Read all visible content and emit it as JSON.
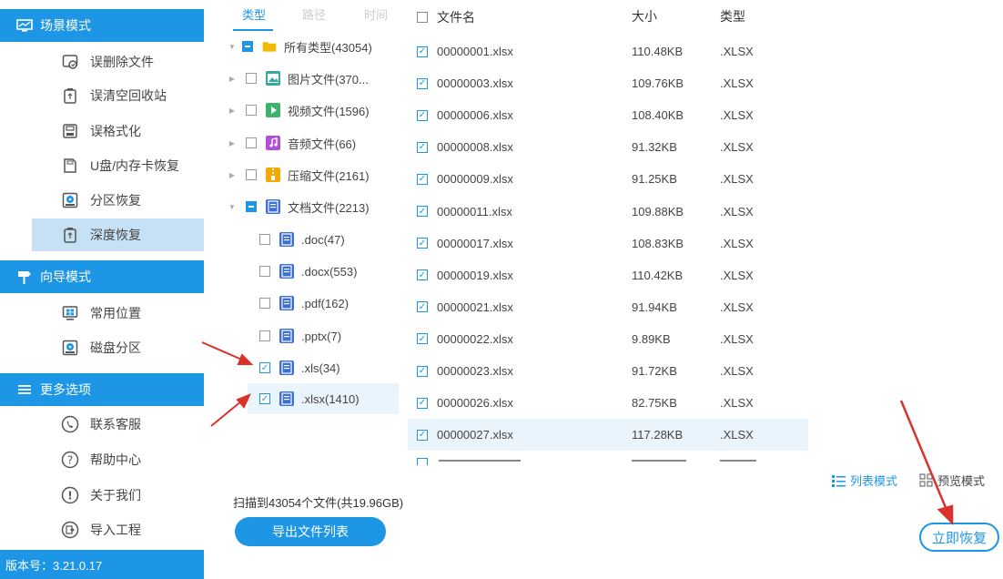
{
  "sidebar": {
    "scene_mode": "场景模式",
    "scene_items": [
      {
        "label": "误删除文件"
      },
      {
        "label": "误清空回收站"
      },
      {
        "label": "误格式化"
      },
      {
        "label": "U盘/内存卡恢复"
      },
      {
        "label": "分区恢复"
      },
      {
        "label": "深度恢复"
      }
    ],
    "guide_mode": "向导模式",
    "guide_items": [
      {
        "label": "常用位置"
      },
      {
        "label": "磁盘分区"
      }
    ],
    "more_options": "更多选项",
    "more_items": [
      {
        "label": "联系客服"
      },
      {
        "label": "帮助中心"
      },
      {
        "label": "关于我们"
      },
      {
        "label": "导入工程"
      }
    ],
    "version": "版本号：3.21.0.17"
  },
  "tree": {
    "tabs": [
      "类型",
      "路径",
      "时间"
    ],
    "rows": [
      {
        "label": "所有类型(43054)"
      },
      {
        "label": "图片文件(370..."
      },
      {
        "label": "视频文件(1596)"
      },
      {
        "label": "音频文件(66)"
      },
      {
        "label": "压缩文件(2161)"
      },
      {
        "label": "文档文件(2213)"
      },
      {
        "label": ".doc(47)"
      },
      {
        "label": ".docx(553)"
      },
      {
        "label": ".pdf(162)"
      },
      {
        "label": ".pptx(7)"
      },
      {
        "label": ".xls(34)"
      },
      {
        "label": ".xlsx(1410)"
      }
    ]
  },
  "list": {
    "headers": {
      "name": "文件名",
      "size": "大小",
      "type": "类型"
    },
    "rows": [
      {
        "name": "00000001.xlsx",
        "size": "110.48KB",
        "type": ".XLSX"
      },
      {
        "name": "00000003.xlsx",
        "size": "109.76KB",
        "type": ".XLSX"
      },
      {
        "name": "00000006.xlsx",
        "size": "108.40KB",
        "type": ".XLSX"
      },
      {
        "name": "00000008.xlsx",
        "size": "91.32KB",
        "type": ".XLSX"
      },
      {
        "name": "00000009.xlsx",
        "size": "91.25KB",
        "type": ".XLSX"
      },
      {
        "name": "00000011.xlsx",
        "size": "109.88KB",
        "type": ".XLSX"
      },
      {
        "name": "00000017.xlsx",
        "size": "108.83KB",
        "type": ".XLSX"
      },
      {
        "name": "00000019.xlsx",
        "size": "110.42KB",
        "type": ".XLSX"
      },
      {
        "name": "00000021.xlsx",
        "size": "91.94KB",
        "type": ".XLSX"
      },
      {
        "name": "00000022.xlsx",
        "size": "9.89KB",
        "type": ".XLSX"
      },
      {
        "name": "00000023.xlsx",
        "size": "91.72KB",
        "type": ".XLSX"
      },
      {
        "name": "00000026.xlsx",
        "size": "82.75KB",
        "type": ".XLSX"
      },
      {
        "name": "00000027.xlsx",
        "size": "117.28KB",
        "type": ".XLSX"
      }
    ]
  },
  "bottom": {
    "scan_summary": "扫描到43054个文件(共19.96GB)",
    "export_label": "导出文件列表",
    "list_mode": "列表模式",
    "preview_mode": "预览模式",
    "recover_label": "立即恢复"
  },
  "colors": {
    "accent": "#1e96e6",
    "selected_bg": "#c6e1f5",
    "annotation_arrow": "#d9322b"
  }
}
